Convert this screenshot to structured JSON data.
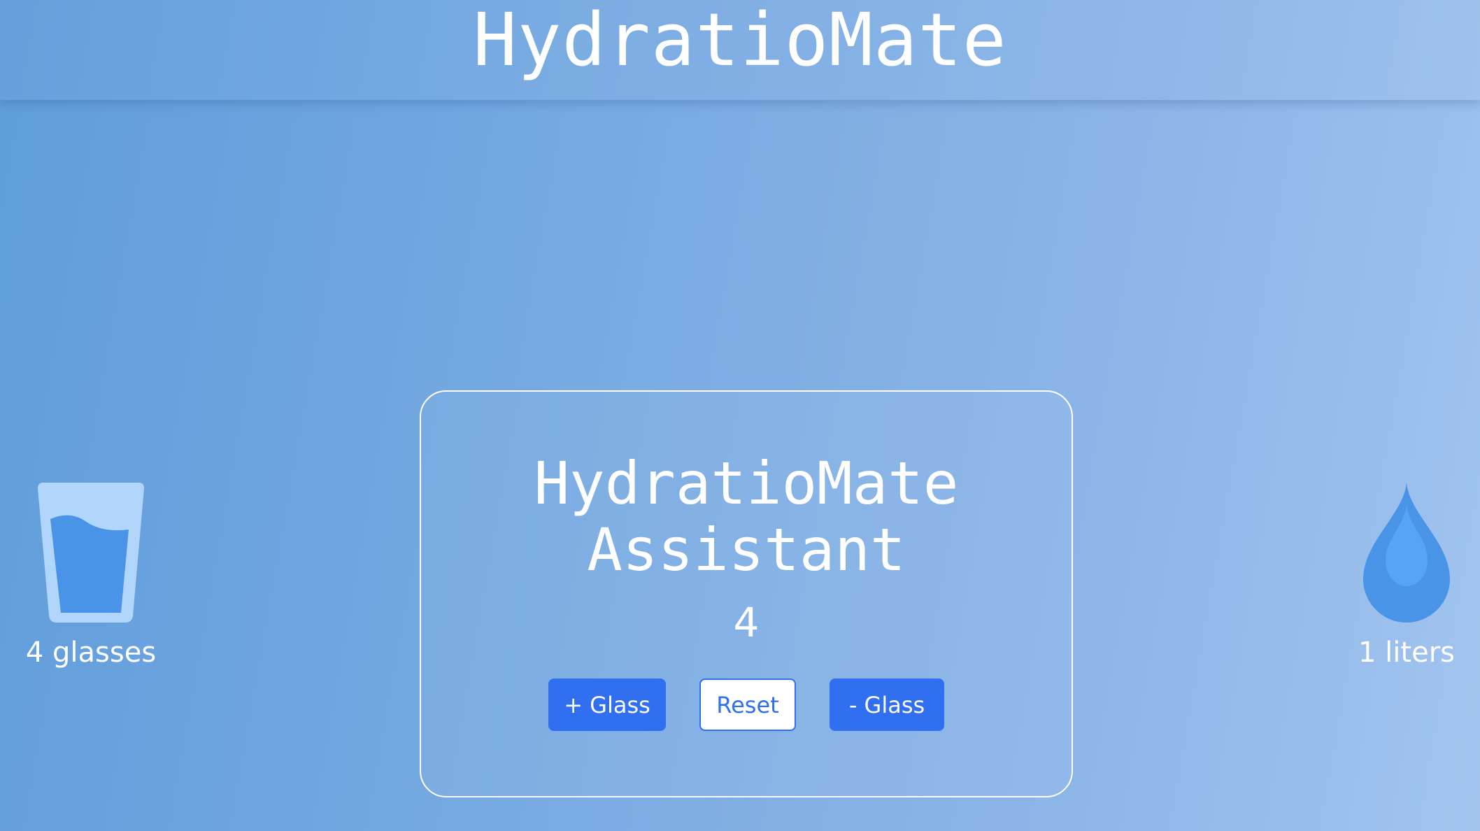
{
  "header": {
    "title": "HydratioMate"
  },
  "glass_stat": {
    "icon": "water-glass-icon",
    "label": "4 glasses"
  },
  "liters_stat": {
    "icon": "water-drop-icon",
    "label": "1 liters"
  },
  "card": {
    "title": "HydratioMate\nAssistant",
    "count": "4",
    "buttons": {
      "add_label": "+ Glass",
      "reset_label": "Reset",
      "subtract_label": "- Glass"
    }
  },
  "colors": {
    "accent": "#2f6ff0",
    "water": "#4a94e8",
    "glass": "#b2d6fb"
  }
}
